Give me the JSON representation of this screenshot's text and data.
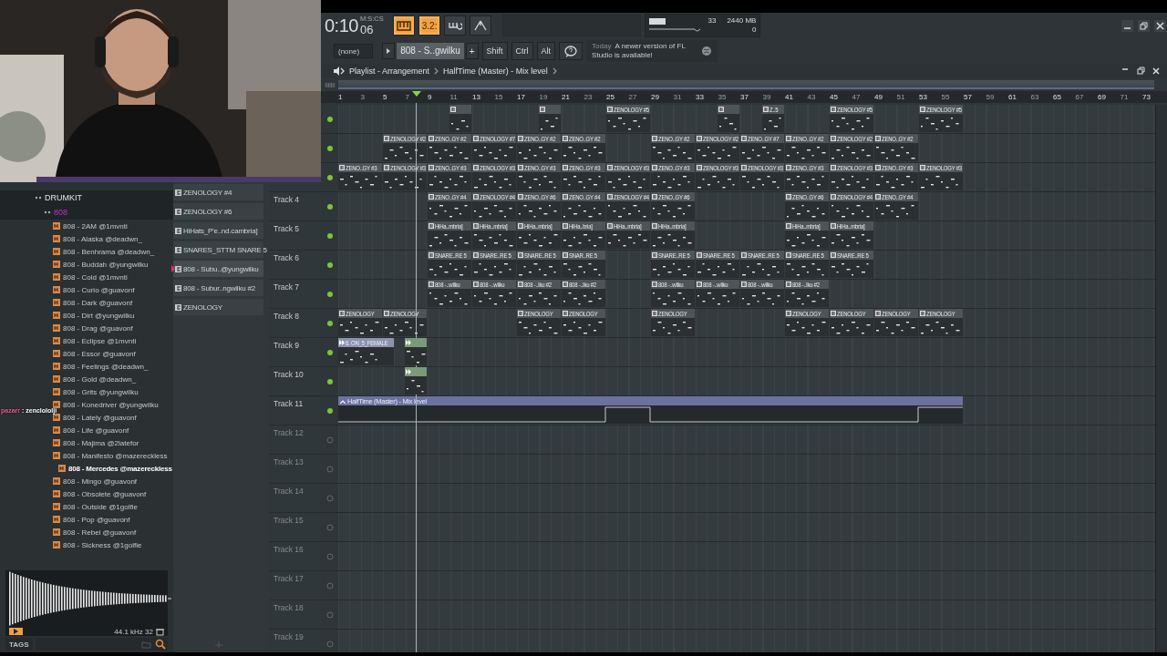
{
  "chat": {
    "user": "pazarr",
    "message": ": zenclololji"
  },
  "toolbar": {
    "time": "0:10",
    "time_cs": "06",
    "time_format": "M:S:CS",
    "toggles": [
      {
        "kind": "keyboard",
        "on": true
      },
      {
        "kind": "step",
        "label": "3.2:",
        "on": true
      },
      {
        "kind": "loop",
        "on": false
      },
      {
        "kind": "metronome",
        "on": false
      }
    ],
    "cpu": "33",
    "memory": "2440 MB",
    "polyphony": "0",
    "pattern": "(none)",
    "channel": "808 - S..gwilku",
    "add": "+",
    "modifiers": [
      "Shift",
      "Ctrl",
      "Alt"
    ],
    "hint_day": "Today",
    "hint": "A newer version of FL Studio is available!"
  },
  "browser": {
    "items": [
      {
        "kind": "folder",
        "label": "DRUMKIT"
      },
      {
        "kind": "subfolder",
        "label": "808"
      },
      {
        "kind": "file",
        "label": "808 - 2AM @1mvnti",
        "selected": false
      },
      {
        "kind": "file",
        "label": "808 - Alaska @deadwn_",
        "selected": false
      },
      {
        "kind": "file",
        "label": "808 - Benhrama @deadwn_",
        "selected": false
      },
      {
        "kind": "file",
        "label": "808 - Buddah @yungwilku",
        "selected": false
      },
      {
        "kind": "file",
        "label": "808 - Cold @1mvnti",
        "selected": false
      },
      {
        "kind": "file",
        "label": "808 - Curio @guavonf",
        "selected": false
      },
      {
        "kind": "file",
        "label": "808 - Dark @guavonf",
        "selected": false
      },
      {
        "kind": "file",
        "label": "808 - Dirt @yungwilku",
        "selected": false
      },
      {
        "kind": "file",
        "label": "808 - Drag @guavonf",
        "selected": false
      },
      {
        "kind": "file",
        "label": "808 - Eclipse @1mvnti",
        "selected": false
      },
      {
        "kind": "file",
        "label": "808 - Essor @guavonf",
        "selected": false
      },
      {
        "kind": "file",
        "label": "808 - Feelings @deadwn_",
        "selected": false
      },
      {
        "kind": "file",
        "label": "808 - Gold @deadwn_",
        "selected": false
      },
      {
        "kind": "file",
        "label": "808 - Grits @yungwilku",
        "selected": false
      },
      {
        "kind": "file",
        "label": "808 - Konedriver @yungwilku",
        "selected": false
      },
      {
        "kind": "file",
        "label": "808 - Lately @guavonf",
        "selected": false
      },
      {
        "kind": "file",
        "label": "808 - Life @guavonf",
        "selected": false
      },
      {
        "kind": "file",
        "label": "808 - Majima @2latefor",
        "selected": false
      },
      {
        "kind": "file",
        "label": "808 - Manifesto @mazereckless",
        "selected": false
      },
      {
        "kind": "file",
        "label": "808 - Mercedes @mazereckless",
        "selected": true
      },
      {
        "kind": "file",
        "label": "808 - Mingo @guavonf",
        "selected": false
      },
      {
        "kind": "file",
        "label": "808 - Obsolete @guavonf",
        "selected": false
      },
      {
        "kind": "file",
        "label": "808 - Outside @1golfie",
        "selected": false
      },
      {
        "kind": "file",
        "label": "808 - Pop @guavonf",
        "selected": false
      },
      {
        "kind": "file",
        "label": "808 - Rebel @guavonf",
        "selected": false
      },
      {
        "kind": "file",
        "label": "808 - Sickness @1golfie",
        "selected": false
      }
    ],
    "sample_info": "44.1 kHz 32",
    "tags_button": "TAGS"
  },
  "channels": [
    {
      "label": "ZENOLOGY #4",
      "selected": false
    },
    {
      "label": "ZENOLOGY #6",
      "selected": false
    },
    {
      "label": "HiHats_P'e..nd.cambria]",
      "selected": false
    },
    {
      "label": "SNARES_STTM SNARE 5",
      "selected": false
    },
    {
      "label": "808 - Subu..@yungwilku",
      "selected": true
    },
    {
      "label": "808 - Subur..ngwilku #2",
      "selected": false
    },
    {
      "label": "ZENOLOGY",
      "selected": false
    }
  ],
  "playlist": {
    "title": "Playlist - Arrangement",
    "target": "HalfTime (Master) - Mix level",
    "ruler": [
      "1",
      "3",
      "5",
      "7",
      "9",
      "11",
      "13",
      "15",
      "17",
      "19",
      "21",
      "23",
      "25",
      "27",
      "29",
      "31",
      "33",
      "35",
      "37",
      "39",
      "41",
      "43",
      "45",
      "47",
      "49",
      "51",
      "53",
      "55",
      "57",
      "59",
      "61",
      "63",
      "65",
      "67",
      "69",
      "71",
      "73"
    ],
    "playhead": {
      "level": 0.098
    },
    "tracks": [
      {
        "active": true,
        "slots": [
          {
            "kind": "gap"
          },
          {
            "kind": "gap"
          },
          {
            "kind": "pattern",
            "short": true
          },
          {
            "kind": "gap"
          },
          {
            "kind": "pattern",
            "short": true
          },
          {
            "kind": "gap"
          },
          {
            "kind": "pattern",
            "label": "ZENOLOGY #5"
          },
          {
            "kind": "gap"
          },
          {
            "kind": "pattern",
            "short": true
          },
          {
            "kind": "pattern",
            "short": true,
            "label": "Z..5"
          },
          {
            "kind": "gap"
          },
          {
            "kind": "pattern",
            "label": "ZENOLOGY #5"
          },
          {
            "kind": "gap"
          },
          {
            "kind": "pattern",
            "label": "ZENOLOGY #5"
          }
        ]
      },
      {
        "active": true,
        "slots": [
          {
            "kind": "gap"
          },
          {
            "kind": "pattern",
            "label": "ZENOLOGY #2"
          },
          {
            "kind": "pattern",
            "label": "ZENO..GY #2"
          },
          {
            "kind": "pattern",
            "label": "ZENOLOGY #7"
          },
          {
            "kind": "pattern",
            "label": "ZENO..GY #2"
          },
          {
            "kind": "pattern",
            "label": "ZENO..GY #2"
          },
          {
            "kind": "gap"
          },
          {
            "kind": "pattern",
            "label": "ZENO..GY #2"
          },
          {
            "kind": "pattern",
            "label": "ZENOLOGY #2"
          },
          {
            "kind": "pattern",
            "label": "ZENO..GY #7"
          },
          {
            "kind": "pattern",
            "label": "ZENO..GY #2"
          },
          {
            "kind": "pattern",
            "label": "ZENOLOGY #2"
          },
          {
            "kind": "pattern",
            "label": "ZENO..GY #2"
          }
        ]
      },
      {
        "active": true,
        "slots": [
          {
            "kind": "pattern",
            "label": "ZENO..GY #3"
          },
          {
            "kind": "pattern",
            "label": "ZENOLOGY #3"
          },
          {
            "kind": "pattern",
            "label": "ZENO..GY #3"
          },
          {
            "kind": "pattern",
            "label": "ZENOLOGY #3"
          },
          {
            "kind": "pattern",
            "label": "ZENO..GY #3"
          },
          {
            "kind": "pattern",
            "label": "ZENO..GY #3"
          },
          {
            "kind": "pattern",
            "label": "ZENOLOGY #3"
          },
          {
            "kind": "pattern",
            "label": "ZENO..GY #3"
          },
          {
            "kind": "pattern",
            "label": "ZENOLOGY #3"
          },
          {
            "kind": "pattern",
            "label": "ZENOLOGY #3"
          },
          {
            "kind": "pattern",
            "label": "ZENO..GY #3"
          },
          {
            "kind": "pattern",
            "label": "ZENOLOGY #3"
          },
          {
            "kind": "pattern",
            "label": "ZENO..GY #3"
          },
          {
            "kind": "pattern",
            "label": "ZENOLOGY #3"
          }
        ]
      },
      {
        "name": "Track 4",
        "active": true,
        "slots": [
          {
            "kind": "gap"
          },
          {
            "kind": "gap"
          },
          {
            "kind": "pattern",
            "label": "ZENO..GY #4"
          },
          {
            "kind": "pattern",
            "label": "ZENOLOGY #4"
          },
          {
            "kind": "pattern",
            "label": "ZENO..GY #6"
          },
          {
            "kind": "pattern",
            "label": "ZENO..GY #4"
          },
          {
            "kind": "pattern",
            "label": "ZENOLOGY #4"
          },
          {
            "kind": "pattern",
            "label": "ZENO..GY #6"
          },
          {
            "kind": "gap"
          },
          {
            "kind": "gap"
          },
          {
            "kind": "pattern",
            "label": "ZENO..GY #6"
          },
          {
            "kind": "pattern",
            "label": "ZENOLOGY #4"
          },
          {
            "kind": "pattern",
            "label": "ZENO..GY #4"
          }
        ]
      },
      {
        "name": "Track 5",
        "active": true,
        "slots": [
          {
            "kind": "gap"
          },
          {
            "kind": "gap"
          },
          {
            "kind": "pattern",
            "label": "HiHa..mbria]"
          },
          {
            "kind": "pattern",
            "label": "HiHa..mbria]"
          },
          {
            "kind": "pattern",
            "label": "HiHa..mbria]"
          },
          {
            "kind": "pattern",
            "label": "HiHa..bria]"
          },
          {
            "kind": "pattern",
            "label": "HiHa..mbria]"
          },
          {
            "kind": "pattern",
            "label": "HiHa..mbria]"
          },
          {
            "kind": "gap"
          },
          {
            "kind": "gap"
          },
          {
            "kind": "pattern",
            "label": "HiHa..mbria]"
          },
          {
            "kind": "pattern",
            "label": "HiHa..mbria]"
          }
        ]
      },
      {
        "name": "Track 6",
        "active": true,
        "slots": [
          {
            "kind": "gap"
          },
          {
            "kind": "gap"
          },
          {
            "kind": "pattern",
            "label": "SNARE..RE 5"
          },
          {
            "kind": "pattern",
            "label": "SNARE..RE 5"
          },
          {
            "kind": "pattern",
            "label": "SNARE..RE 5"
          },
          {
            "kind": "pattern",
            "label": "SNAR..RE 5"
          },
          {
            "kind": "gap"
          },
          {
            "kind": "pattern",
            "label": "SNARE..RE 5"
          },
          {
            "kind": "pattern",
            "label": "SNARE..RE 5"
          },
          {
            "kind": "pattern",
            "label": "SNARE..RE 5"
          },
          {
            "kind": "pattern",
            "label": "SNARE..RE 5"
          },
          {
            "kind": "pattern",
            "label": "SNARE..RE 5"
          }
        ]
      },
      {
        "name": "Track 7",
        "active": true,
        "slots": [
          {
            "kind": "gap"
          },
          {
            "kind": "gap"
          },
          {
            "kind": "pattern",
            "label": "808 -..wilku"
          },
          {
            "kind": "pattern",
            "label": "808 -..wilku"
          },
          {
            "kind": "pattern",
            "label": "808 -..lku #2"
          },
          {
            "kind": "pattern",
            "label": "808 -..lku #2"
          },
          {
            "kind": "gap"
          },
          {
            "kind": "pattern",
            "label": "808 -..wilku"
          },
          {
            "kind": "pattern",
            "label": "808 -..wilku"
          },
          {
            "kind": "pattern",
            "label": "808 -..wilku"
          },
          {
            "kind": "pattern",
            "label": "808 -..lku #2"
          }
        ]
      },
      {
        "name": "Track 8",
        "active": true,
        "slots": [
          {
            "kind": "pattern",
            "label": "ZENOLOGY"
          },
          {
            "kind": "pattern",
            "label": "ZENOLOGY"
          },
          {
            "kind": "gap"
          },
          {
            "kind": "gap"
          },
          {
            "kind": "pattern",
            "label": "ZENOLOGY"
          },
          {
            "kind": "pattern",
            "label": "ZENOLOGY"
          },
          {
            "kind": "gap"
          },
          {
            "kind": "pattern",
            "label": "ZENOLOGY"
          },
          {
            "kind": "gap"
          },
          {
            "kind": "gap"
          },
          {
            "kind": "pattern",
            "label": "ZENOLOGY"
          },
          {
            "kind": "pattern",
            "label": "ZENOLOGY"
          },
          {
            "kind": "pattern",
            "label": "ZENOLOGY"
          },
          {
            "kind": "pattern",
            "label": "ZENOLOGY"
          }
        ]
      },
      {
        "name": "Track 9",
        "active": true,
        "slots": [
          {
            "kind": "audio",
            "label": "6. ON_5_FEMALE"
          },
          {
            "kind": "audio",
            "short": true
          }
        ]
      },
      {
        "name": "Track 10",
        "active": true,
        "slots": [
          {
            "kind": "gap"
          },
          {
            "kind": "audio",
            "short": true
          }
        ]
      },
      {
        "name": "Track 11",
        "active": true,
        "slots": [
          {
            "kind": "automation",
            "label": "HalfTime (Master) - Mix level"
          }
        ]
      },
      {
        "name": "Track 12",
        "active": false
      },
      {
        "name": "Track 13",
        "active": false
      },
      {
        "name": "Track 14",
        "active": false
      },
      {
        "name": "Track 15",
        "active": false
      },
      {
        "name": "Track 16",
        "active": false
      },
      {
        "name": "Track 17",
        "active": false
      },
      {
        "name": "Track 18",
        "active": false
      },
      {
        "name": "Track 19",
        "active": false
      }
    ]
  }
}
